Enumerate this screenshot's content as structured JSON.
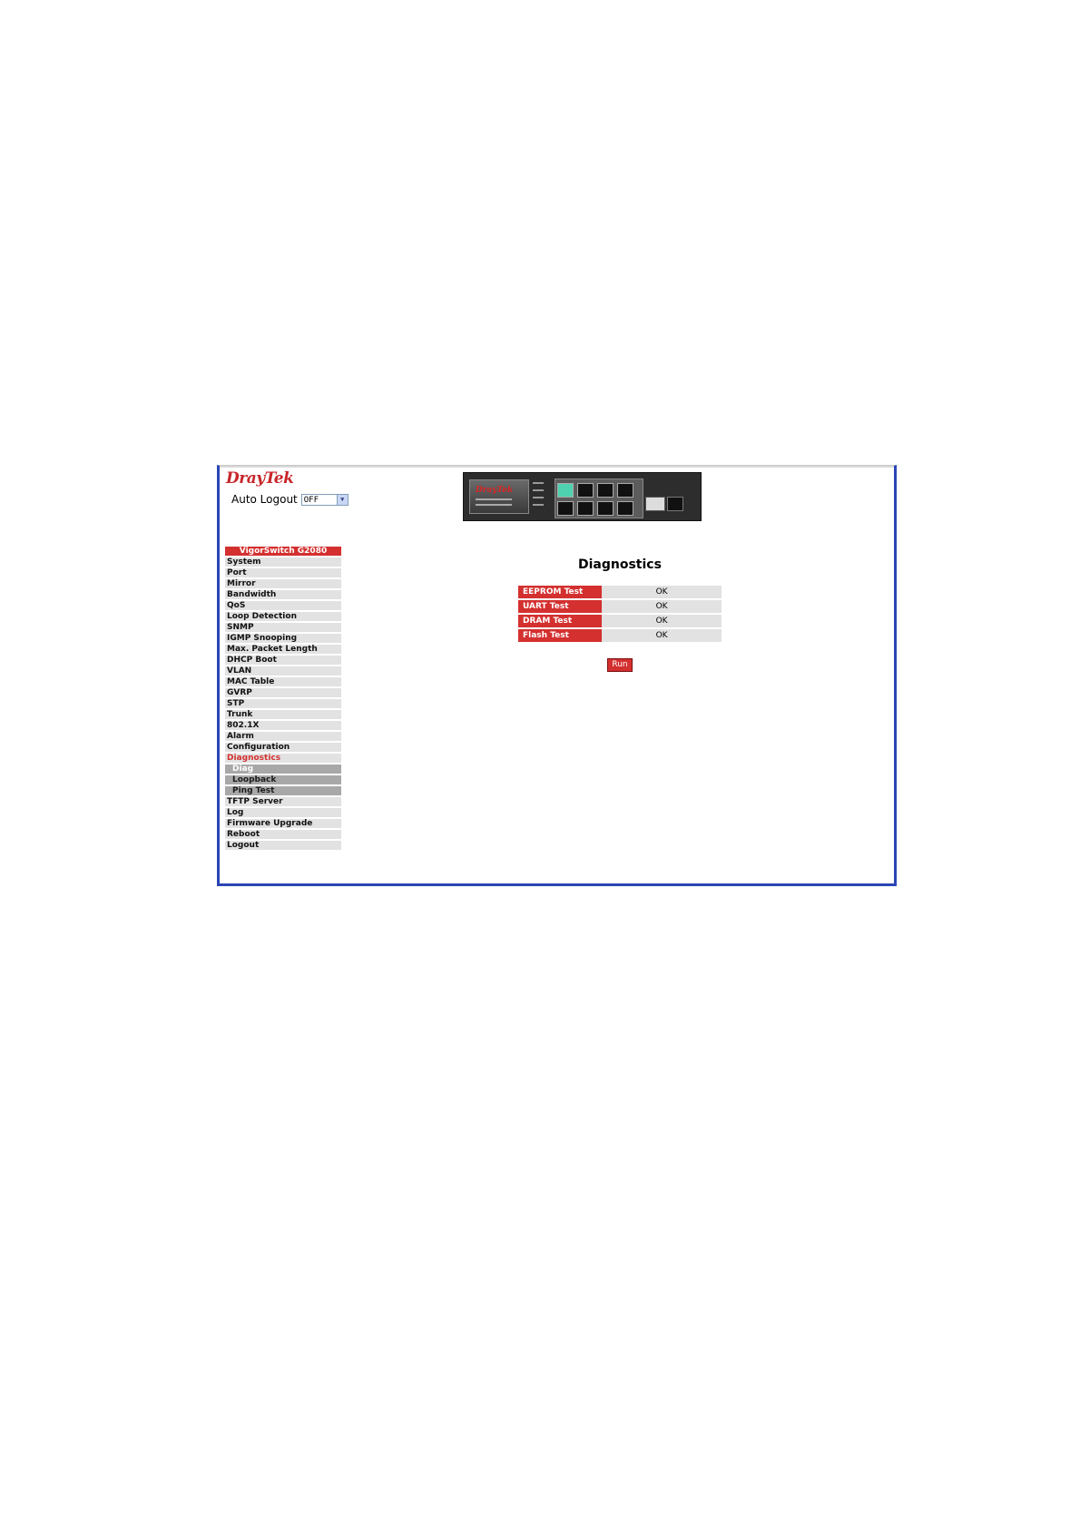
{
  "header": {
    "logo_dray": "Dray",
    "logo_tek": "Tek",
    "auto_logout_label": "Auto Logout",
    "auto_logout_value": "OFF"
  },
  "sidebar": {
    "title": "VigorSwitch G2080",
    "items": [
      "System",
      "Port",
      "Mirror",
      "Bandwidth",
      "QoS",
      "Loop Detection",
      "SNMP",
      "IGMP Snooping",
      "Max. Packet Length",
      "DHCP Boot",
      "VLAN",
      "MAC Table",
      "GVRP",
      "STP",
      "Trunk",
      "802.1X",
      "Alarm",
      "Configuration",
      "Diagnostics"
    ],
    "subitems": [
      "Diag",
      "Loopback",
      "Ping Test"
    ],
    "items_after": [
      "TFTP Server",
      "Log",
      "Firmware Upgrade",
      "Reboot",
      "Logout"
    ]
  },
  "main": {
    "title": "Diagnostics",
    "tests": [
      {
        "label": "EEPROM Test",
        "result": "OK"
      },
      {
        "label": "UART Test",
        "result": "OK"
      },
      {
        "label": "DRAM Test",
        "result": "OK"
      },
      {
        "label": "Flash Test",
        "result": "OK"
      }
    ],
    "run_label": "Run"
  },
  "colors": {
    "accent": "#d3302f",
    "frame": "#2a45b5",
    "row": "#e2e2e2",
    "submenu": "#a8a8a8"
  }
}
